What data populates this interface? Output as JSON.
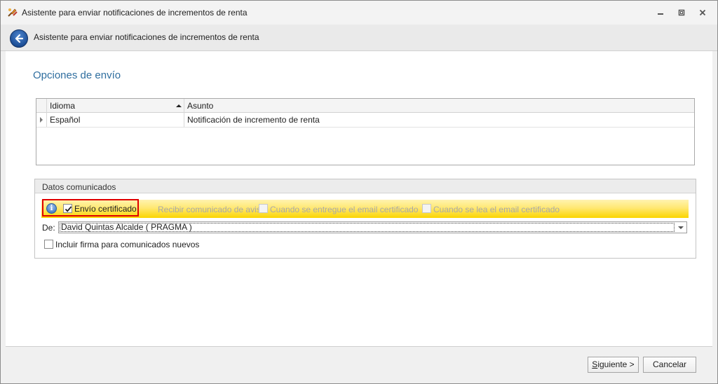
{
  "window": {
    "title": "Asistente para enviar notificaciones de incrementos de renta"
  },
  "header": {
    "title": "Asistente para enviar notificaciones de incrementos de renta"
  },
  "section": {
    "title": "Opciones de envío"
  },
  "grid": {
    "columns": [
      "Idioma",
      "Asunto"
    ],
    "sort_column": "Idioma",
    "rows": [
      {
        "idioma": "Español",
        "asunto": "Notificación de incremento de renta"
      }
    ]
  },
  "datos": {
    "group_title": "Datos comunicados",
    "envio_certificado": {
      "label": "Envío certificado",
      "checked": true
    },
    "recibir_label": "Recibir comunicado de aviso:",
    "cuando_entregue": {
      "label": "Cuando se entregue el email certificado",
      "checked": false,
      "disabled": true
    },
    "cuando_lea": {
      "label": "Cuando se lea el email certificado",
      "checked": false,
      "disabled": true
    },
    "de_label": "De:",
    "de_value": "David Quintas Alcalde ( PRAGMA )",
    "incluir_firma": {
      "label": "Incluir firma para comunicados nuevos",
      "checked": false
    }
  },
  "footer": {
    "siguiente_first": "S",
    "siguiente_rest": "iguiente >",
    "cancelar": "Cancelar"
  },
  "colors": {
    "accent_title": "#2f6e9f",
    "highlight_border": "#e00000",
    "info_bar": "#fbd500"
  }
}
